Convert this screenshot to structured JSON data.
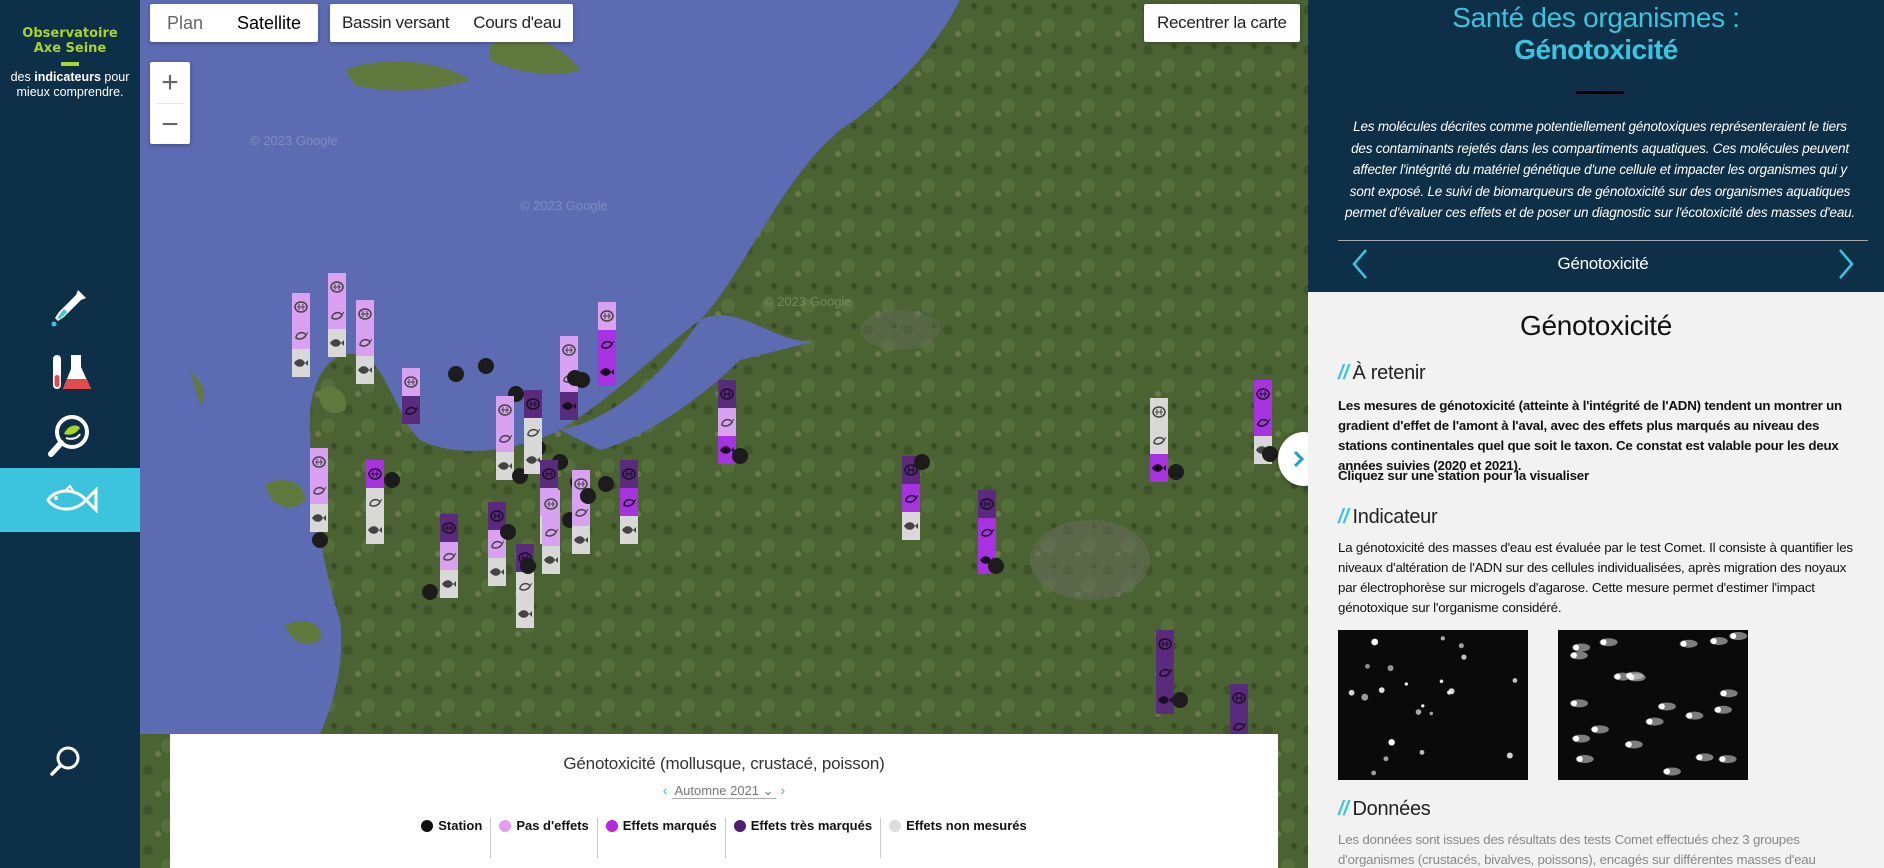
{
  "sidebar": {
    "logo_line1": "Observatoire",
    "logo_line2": "Axe Seine",
    "tagline_pre": "des ",
    "tagline_bold": "indicateurs",
    "tagline_post": " pour mieux comprendre.",
    "items": [
      {
        "icon": "pipette-icon"
      },
      {
        "icon": "flask-icon"
      },
      {
        "icon": "magnifier-bio-icon"
      },
      {
        "icon": "fish-icon",
        "active": true
      }
    ],
    "search_icon": "search-icon"
  },
  "map": {
    "type_plan": "Plan",
    "type_satellite": "Satellite",
    "layer_bassin": "Bassin versant",
    "layer_cours": "Cours d'eau",
    "recenter": "Recentrer la carte",
    "zoom_in": "+",
    "zoom_out": "−",
    "watermark": "© 2023 Google",
    "colors": {
      "pas_effet": "#d9a2f0",
      "marques": "#a733e0",
      "tres_marques": "#5a2a7d",
      "non_mesures": "#d8d8d8",
      "station": "#1c1c1c"
    }
  },
  "legend": {
    "title": "Génotoxicité (mollusque, crustacé, poisson)",
    "season": "Automne 2021",
    "items": [
      {
        "label": "Station",
        "color": "#111111"
      },
      {
        "label": "Pas d'effets",
        "color": "#e59bf0"
      },
      {
        "label": "Effets marqués",
        "color": "#b726e0"
      },
      {
        "label": "Effets très marqués",
        "color": "#4d1f6e"
      },
      {
        "label": "Effets non mesurés",
        "color": "#dddddd"
      }
    ]
  },
  "panel": {
    "title1": "Santé des organismes :",
    "title2": "Génotoxicité",
    "intro": "Les molécules décrites comme potentiellement génotoxiques représenteraient le tiers des contaminants rejetés dans les compartiments aquatiques. Ces molécules peuvent affecter l'intégrité du matériel génétique d'une cellule et impacter les organismes qui y sont exposé. Le suivi de biomarqueurs de génotoxicité sur des organismes aquatiques permet d'évaluer ces effets et de poser un diagnostic sur l'écotoxicité des masses d'eau.",
    "nav_label": "Génotoxicité",
    "body_title": "Génotoxicité",
    "sec1_title": "À retenir",
    "sec1_text": "Les mesures de génotoxicité (atteinte à l'intégrité de l'ADN) tendent un montrer un gradient d'effet de l'amont à l'aval, avec des effets plus marqués au niveau des stations continentales quel que soit le taxon. Ce constat est valable pour les deux années suivies (2020 et 2021).",
    "sec1_cta": "Cliquez sur une station pour la visualiser",
    "sec2_title": "Indicateur",
    "sec2_text": "La génotoxicité des masses d'eau est évaluée par le test Comet. Il consiste à quantifier les niveaux d'altération de l'ADN sur des cellules individualisées, après migration des noyaux par électrophorèse sur microgels d'agarose. Cette mesure permet d'estimer l'impact génotoxique sur l'organisme considéré.",
    "sec3_title": "Données",
    "sec3_text": "Les données sont issues des résultats des tests Comet effectués chez 3 groupes d'organismes (crustacés, bivalves, poissons), encagés sur différentes masses d'eau (continentales, de"
  }
}
